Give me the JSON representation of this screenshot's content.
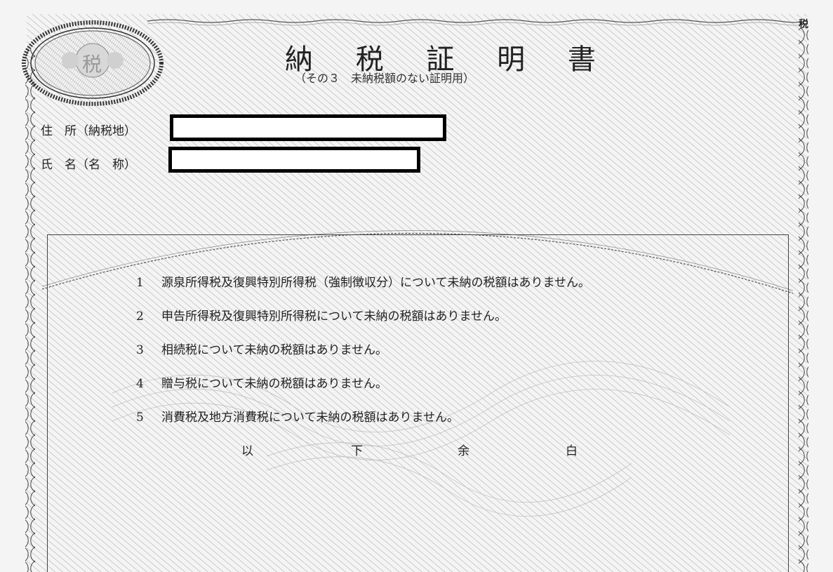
{
  "document": {
    "title": "納 税 証 明 書",
    "subtitle": "（その３　未納税額のない証明用）",
    "seal_text": "税",
    "corner_mark": "税"
  },
  "fields": {
    "address_label": "住　所（納税地）",
    "name_label": "氏　名（名　称）"
  },
  "items": [
    {
      "num": "1",
      "text": "源泉所得税及復興特別所得税（強制徴収分）について未納の税額はありません。"
    },
    {
      "num": "2",
      "text": "申告所得税及復興特別所得税について未納の税額はありません。"
    },
    {
      "num": "3",
      "text": "相続税について未納の税額はありません。"
    },
    {
      "num": "4",
      "text": "贈与税について未納の税額はありません。"
    },
    {
      "num": "5",
      "text": "消費税及地方消費税について未納の税額はありません。"
    }
  ],
  "closing": [
    "以",
    "下",
    "余",
    "白"
  ],
  "colors": {
    "background": "#f4f4f4",
    "pattern": "#8a8a8a",
    "ink": "#222222"
  }
}
